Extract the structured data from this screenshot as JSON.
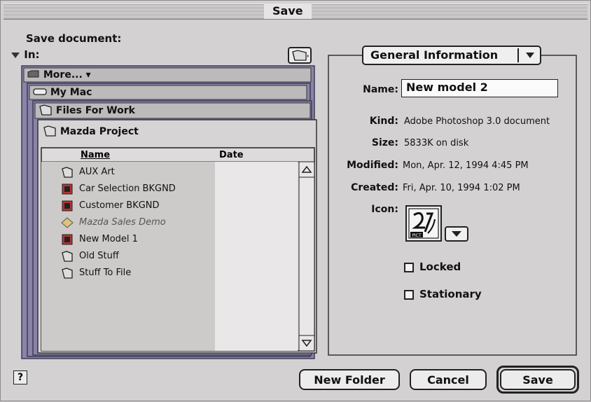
{
  "window": {
    "title": "Save"
  },
  "prompt": "Save document:",
  "in_label": "In:",
  "stack": {
    "levels": [
      "More...",
      "My Mac",
      "Files For Work",
      "Mazda Project"
    ]
  },
  "list": {
    "headers": {
      "name": "Name",
      "date": "Date"
    },
    "items": [
      {
        "name": "AUX Art",
        "icon": "folder-icon"
      },
      {
        "name": "Car Selection BKGND",
        "icon": "photoshop-doc-icon"
      },
      {
        "name": "Customer BKGND",
        "icon": "photoshop-doc-icon"
      },
      {
        "name": "Mazda Sales Demo",
        "icon": "alias-app-icon"
      },
      {
        "name": "New Model 1",
        "icon": "photoshop-doc-icon"
      },
      {
        "name": "Old Stuff",
        "icon": "folder-icon"
      },
      {
        "name": "Stuff To File",
        "icon": "folder-icon"
      }
    ]
  },
  "info": {
    "panel_title": "General Information",
    "name_label": "Name:",
    "name_value": "New model 2",
    "kind_label": "Kind:",
    "kind_value": "Adobe Photoshop 3.0 document",
    "size_label": "Size:",
    "size_value": "5833K on disk",
    "modified_label": "Modified:",
    "modified_value": "Mon, Apr. 12, 1994 4:45 PM",
    "created_label": "Created:",
    "created_value": "Fri, Apr. 10, 1994 1:02 PM",
    "icon_label": "Icon:",
    "icon_text": "PICT",
    "locked_label": "Locked",
    "stationary_label": "Stationary"
  },
  "buttons": {
    "help": "?",
    "new_folder": "New Folder",
    "cancel": "Cancel",
    "save": "Save"
  }
}
